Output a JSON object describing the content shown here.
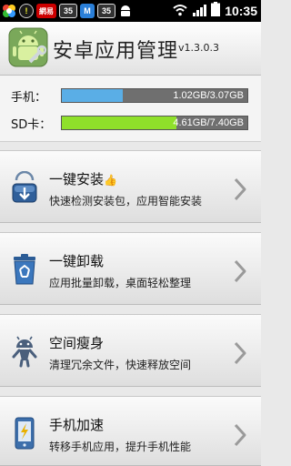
{
  "status_bar": {
    "time": "10:35",
    "badges": [
      "!",
      "網易",
      "35",
      "M",
      "35"
    ],
    "icons": [
      "flower-icon",
      "shield-icon",
      "netease-icon",
      "calendar-icon",
      "maxthon-icon",
      "calendar-icon",
      "wifi-icon",
      "signal-icon",
      "battery-icon"
    ]
  },
  "header": {
    "title": "安卓应用管理",
    "version": "v1.3.0.3"
  },
  "storage": {
    "phone": {
      "label": "手机：",
      "text": "1.02GB/3.07GB",
      "used_fraction": 0.33,
      "color": "#5aaee6"
    },
    "sd": {
      "label": "SD卡：",
      "text": "4.61GB/7.40GB",
      "used_fraction": 0.62,
      "color": "#8fe02a"
    }
  },
  "menu": [
    {
      "title": "一键安装",
      "subtitle": "快速检测安装包，应用智能安装",
      "icon": "install-icon"
    },
    {
      "title": "一键卸载",
      "subtitle": "应用批量卸载，桌面轻松整理",
      "icon": "recycle-bin-icon"
    },
    {
      "title": "空间瘦身",
      "subtitle": "清理冗余文件，快速释放空间",
      "icon": "android-slim-icon"
    },
    {
      "title": "手机加速",
      "subtitle": "转移手机应用，提升手机性能",
      "icon": "phone-speed-icon"
    }
  ]
}
